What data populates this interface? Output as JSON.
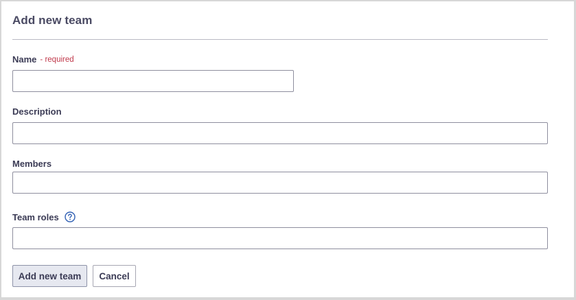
{
  "form": {
    "title": "Add new team",
    "fields": {
      "name": {
        "label": "Name",
        "required_text": "- required",
        "value": "",
        "placeholder": ""
      },
      "description": {
        "label": "Description",
        "value": "",
        "placeholder": ""
      },
      "members": {
        "label": "Members",
        "value": "",
        "placeholder": ""
      },
      "team_roles": {
        "label": "Team roles",
        "help_icon": "question-circle-icon",
        "value": "",
        "placeholder": ""
      }
    },
    "buttons": {
      "submit_label": "Add new team",
      "cancel_label": "Cancel"
    }
  },
  "colors": {
    "required": "#c0394b",
    "help_icon": "#2f5fb3",
    "label": "#3b3b55"
  }
}
